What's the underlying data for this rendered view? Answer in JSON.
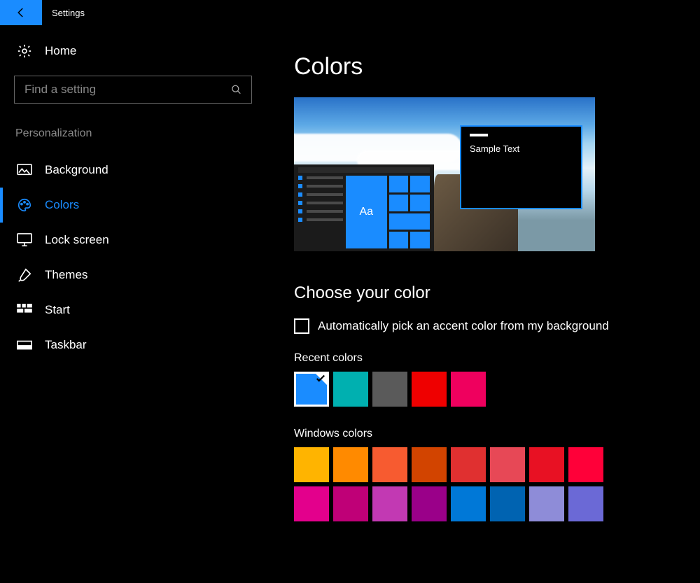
{
  "app_title": "Settings",
  "home_label": "Home",
  "search_placeholder": "Find a setting",
  "group_label": "Personalization",
  "nav": [
    {
      "id": "background",
      "label": "Background",
      "active": false
    },
    {
      "id": "colors",
      "label": "Colors",
      "active": true
    },
    {
      "id": "lockscreen",
      "label": "Lock screen",
      "active": false
    },
    {
      "id": "themes",
      "label": "Themes",
      "active": false
    },
    {
      "id": "start",
      "label": "Start",
      "active": false
    },
    {
      "id": "taskbar",
      "label": "Taskbar",
      "active": false
    }
  ],
  "page_title": "Colors",
  "preview": {
    "tile_text": "Aa",
    "window_text": "Sample Text"
  },
  "choose_color": {
    "heading": "Choose your color",
    "auto_pick_label": "Automatically pick an accent color from my background",
    "auto_pick_checked": false
  },
  "recent_colors": {
    "label": "Recent colors",
    "colors": [
      "#1a8cff",
      "#00b0b0",
      "#5a5a5a",
      "#ef0000",
      "#ef005e"
    ],
    "selected_index": 0
  },
  "windows_colors": {
    "label": "Windows colors",
    "colors": [
      "#ffb400",
      "#ff8a00",
      "#f75b30",
      "#d24400",
      "#e03030",
      "#e74856",
      "#e81123",
      "#ff0039",
      "#e3008c",
      "#bf0077",
      "#c239b3",
      "#9a0089",
      "#0078d7",
      "#0063b1",
      "#8e8cd8",
      "#6b69d6"
    ]
  },
  "accent_color": "#1a8cff"
}
